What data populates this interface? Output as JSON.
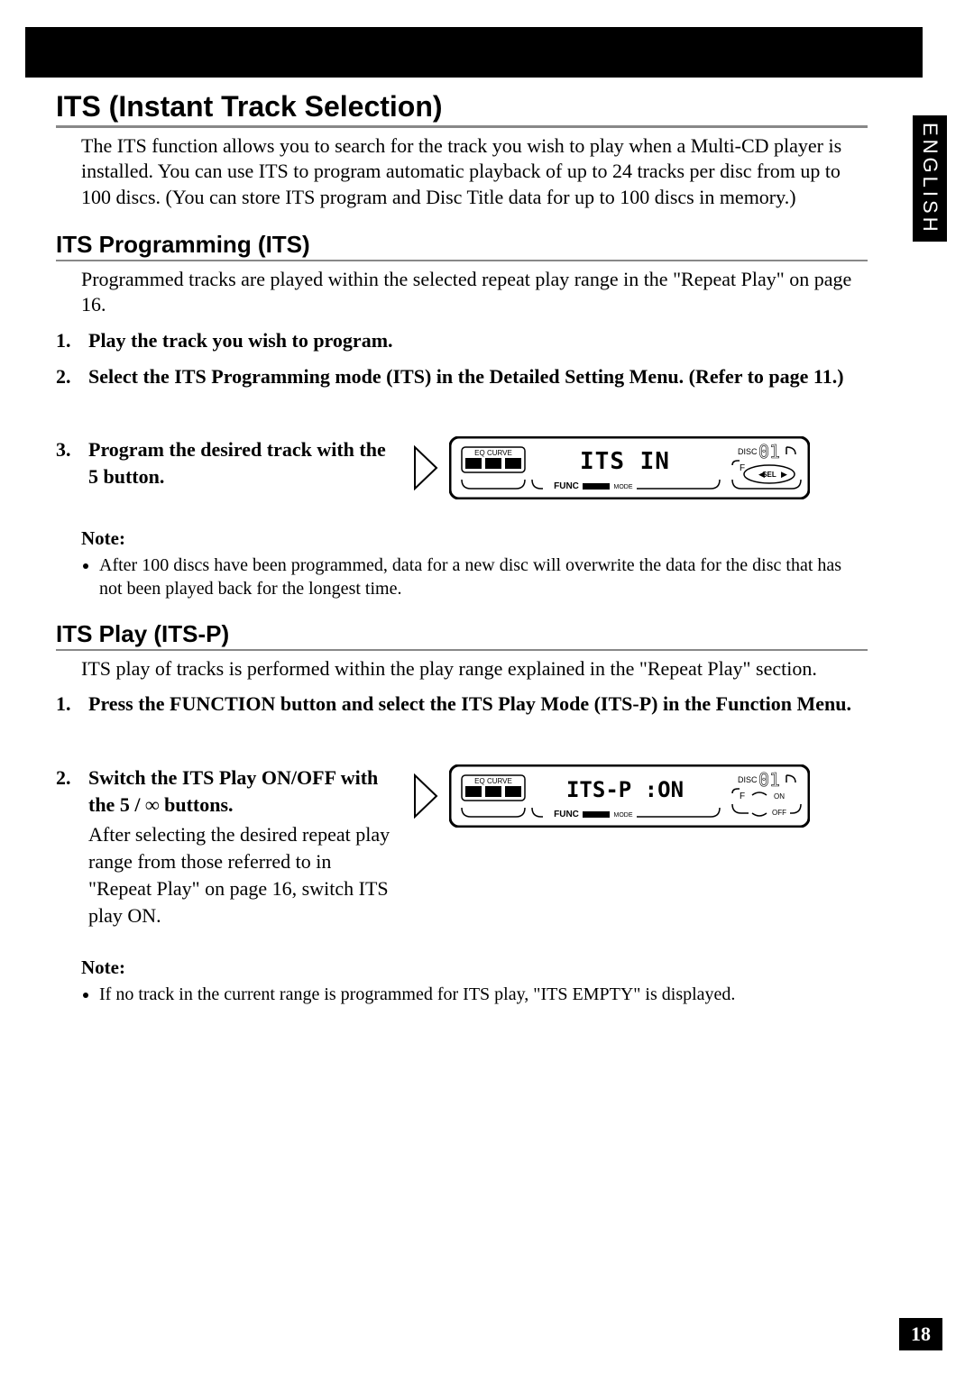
{
  "language_tab": "ENGLISH",
  "page_number": "18",
  "section": {
    "title": "ITS (Instant Track Selection)",
    "intro": "The ITS function allows you to search for the track you wish to play when a Multi-CD player is installed. You can use ITS to program automatic playback of up to 24 tracks per disc from up to 100 discs. (You can store ITS program and Disc Title data for up to 100 discs in memory.)"
  },
  "its_programming": {
    "title": "ITS Programming (ITS)",
    "intro": "Programmed tracks are played within the selected repeat play range in the \"Repeat Play\" on page 16.",
    "steps": [
      "Play the track you wish to program.",
      "Select the ITS Programming mode (ITS) in the Detailed Setting Menu. (Refer to page 11.)",
      "Program the desired track with the 5 button."
    ],
    "display_text": "ITS IN",
    "note_label": "Note:",
    "note": "After 100 discs have been programmed, data for a new disc will overwrite the data for the disc that has not been played back for the longest time."
  },
  "its_play": {
    "title": "ITS Play (ITS-P)",
    "intro": "ITS play of tracks is performed within the play range explained in the \"Repeat Play\" section.",
    "steps": [
      "Press the FUNCTION button and select the ITS Play Mode (ITS-P) in the Function Menu.",
      "Switch the ITS Play ON/OFF with the 5 / ∞ buttons."
    ],
    "step2_sub": "After selecting the desired repeat play range from those referred to in \"Repeat Play\" on page 16, switch ITS play ON.",
    "display_text": "ITS-P :ON",
    "note_label": "Note:",
    "note": "If no track in the current range is programmed for ITS play, \"ITS EMPTY\" is displayed."
  },
  "lcd": {
    "eq_curve": "EQ CURVE",
    "func": "FUNC",
    "mode": "MODE",
    "disc": "DISC",
    "disc_num": "01",
    "sel": "SEL",
    "on": "ON",
    "off": "OFF",
    "f": "F"
  }
}
